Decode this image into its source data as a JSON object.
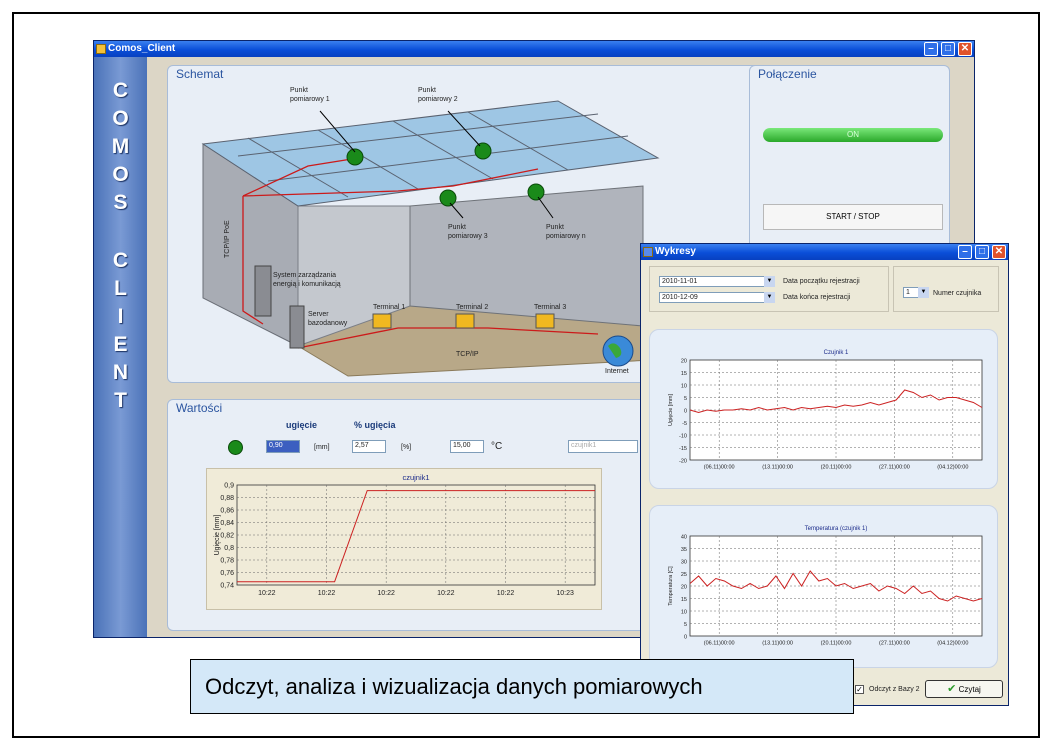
{
  "main_window": {
    "title": "Comos_Client"
  },
  "sidebar": {
    "letters": [
      "C",
      "O",
      "M",
      "O",
      "S",
      "C",
      "L",
      "I",
      "E",
      "N",
      "T"
    ]
  },
  "schemat": {
    "title": "Schemat",
    "labels": {
      "punkt1": "Punkt\npomiarowy 1",
      "punkt2": "Punkt\npomiarowy 2",
      "punkt3": "Punkt\npomiarowy 3",
      "punktn": "Punkt\npomiarowy n",
      "tcp_poe": "TCP/IP PoE",
      "system": "System zarządzania\nenergią i komunikacją",
      "server": "Server\nbazodanowy",
      "terminal1": "Terminal 1",
      "terminal2": "Terminal 2",
      "terminal3": "Terminal 3",
      "tcpip": "TCP/IP",
      "internet": "Internet"
    }
  },
  "polaczenie": {
    "title": "Połączenie",
    "status": "ON",
    "start_stop": "START / STOP"
  },
  "wartosci": {
    "title": "Wartości",
    "ugiecie_label": "ugięcie",
    "proc_ugiecia_label": "% ugięcia",
    "ugiecie_value": "0,90",
    "ugiecie_unit": "[mm]",
    "proc_value": "2,57",
    "proc_unit": "[%]",
    "temp_value": "15,00",
    "temp_unit": "°C",
    "sensor_field": "czujnik1",
    "accent": "#1a8a1a"
  },
  "chart_data": [
    {
      "type": "line",
      "title": "czujnik1",
      "ylabel": "Ugięcie [mm]",
      "xlabel": "",
      "categories": [
        "10:22",
        "10:22",
        "10:22",
        "10:22",
        "10:22",
        "10:23"
      ],
      "ylim": [
        0.73,
        0.91
      ],
      "yticks": [
        "0,9",
        "0,88",
        "0,86",
        "0,84",
        "0,82",
        "0,8",
        "0,78",
        "0,76",
        "0,74"
      ],
      "series": [
        {
          "values": [
            0.736,
            0.736,
            0.736,
            0.736,
            0.9,
            0.9,
            0.9,
            0.9,
            0.9,
            0.9,
            0.9,
            0.9
          ],
          "color": "#cc2222"
        }
      ],
      "grid": true
    },
    {
      "type": "line",
      "title": "Czujnik 1",
      "ylabel": "Ugięcie [mm]",
      "xlabel": "",
      "categories": [
        "(06.11)00:00",
        "(13.11)00:00",
        "(20.11)00:00",
        "(27.11)00:00",
        "(04.12)00:00"
      ],
      "ylim": [
        -20,
        20
      ],
      "yticks": [
        "20",
        "15",
        "10",
        "5",
        "0",
        "-5",
        "-10",
        "-15",
        "-20"
      ],
      "series": [
        {
          "values": [
            0,
            -1,
            0,
            -0.5,
            0,
            0,
            0.5,
            0,
            1,
            0,
            0.5,
            1,
            0,
            1,
            0.5,
            1,
            1.5,
            1,
            2,
            1.5,
            2,
            3,
            2,
            3,
            4,
            8,
            7,
            5,
            6,
            4,
            5,
            5,
            4,
            3,
            1
          ],
          "color": "#cc2222"
        }
      ],
      "grid": true
    },
    {
      "type": "line",
      "title": "Temperatura (czujnik 1)",
      "ylabel": "Temperatura [C]",
      "xlabel": "",
      "categories": [
        "(06.11)00:00",
        "(13.11)00:00",
        "(20.11)00:00",
        "(27.11)00:00",
        "(04.12)00:00"
      ],
      "ylim": [
        0,
        40
      ],
      "yticks": [
        "40",
        "35",
        "30",
        "25",
        "20",
        "15",
        "10",
        "5",
        "0"
      ],
      "series": [
        {
          "values": [
            21,
            24,
            20,
            23,
            22,
            20,
            19,
            21,
            19,
            20,
            24,
            19,
            25,
            20,
            26,
            22,
            23,
            20,
            21,
            19,
            20,
            21,
            18,
            20,
            19,
            17,
            20,
            17,
            18,
            15,
            14,
            16,
            15,
            14,
            15
          ],
          "color": "#cc2222"
        }
      ],
      "grid": true
    }
  ],
  "wykresy": {
    "title": "Wykresy",
    "date_start": "2010-11-01",
    "date_start_label": "Data początku rejestracji",
    "date_end": "2010-12-09",
    "date_end_label": "Data końca rejestracji",
    "sensor_num": "1",
    "sensor_num_label": "Numer czujnika",
    "checkbox_label": "Odczyt z Bazy 2",
    "read_button": "Czytaj"
  },
  "caption": "Odczyt, analiza i wizualizacja danych pomiarowych"
}
